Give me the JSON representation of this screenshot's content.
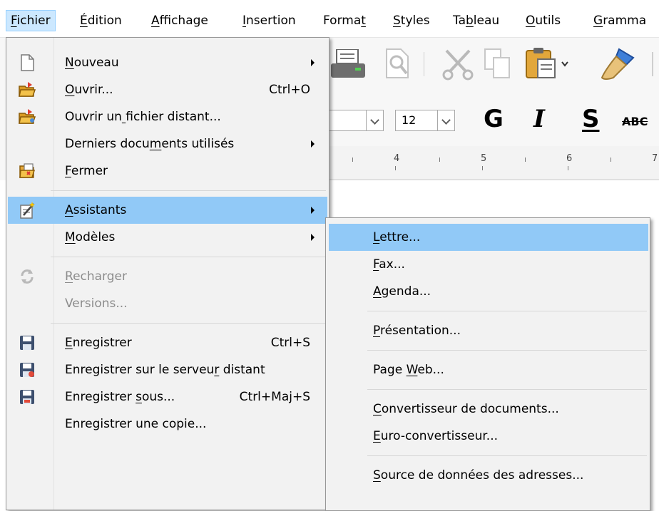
{
  "menubar": {
    "items": [
      {
        "label": "Fichier",
        "ul": 0
      },
      {
        "label": "Édition",
        "ul": 0
      },
      {
        "label": "Affichage",
        "ul": 0
      },
      {
        "label": "Insertion",
        "ul": 0
      },
      {
        "label": "Format",
        "ul": 5
      },
      {
        "label": "Styles",
        "ul": 0
      },
      {
        "label": "Tableau",
        "ul": 2
      },
      {
        "label": "Outils",
        "ul": 0
      },
      {
        "label": "Gramma",
        "ul": 0
      }
    ]
  },
  "toolbar": {
    "font_size": "12",
    "bold_glyph": "G",
    "italic_glyph": "I",
    "underline_glyph": "S",
    "strike_glyph": "ABC",
    "ruler_numbers": [
      "4",
      "5",
      "6",
      "7"
    ]
  },
  "file_menu": {
    "items": [
      {
        "label": "Nouveau",
        "ul": 0,
        "arrow": true,
        "icon": "new-document-icon"
      },
      {
        "label": "Ouvrir...",
        "ul": 0,
        "shortcut": "Ctrl+O",
        "icon": "open-folder-icon"
      },
      {
        "label": "Ouvrir un fichier distant...",
        "ul": 9,
        "icon": "open-remote-folder-icon"
      },
      {
        "label": "Derniers documents utilisés",
        "ul": 13,
        "arrow": true
      },
      {
        "label": "Fermer",
        "ul": 0,
        "icon": "close-document-icon"
      },
      {
        "separator": true
      },
      {
        "label": "Assistants",
        "ul": 0,
        "arrow": true,
        "highlighted": true,
        "icon": "wizard-icon"
      },
      {
        "label": "Modèles",
        "ul": 0,
        "arrow": true
      },
      {
        "separator": true
      },
      {
        "label": "Recharger",
        "ul": 0,
        "disabled": true,
        "icon": "reload-icon"
      },
      {
        "label": "Versions...",
        "disabled": true
      },
      {
        "separator": true
      },
      {
        "label": "Enregistrer",
        "ul": 0,
        "shortcut": "Ctrl+S",
        "icon": "save-icon"
      },
      {
        "label": "Enregistrer sur le serveur distant",
        "ul": 25,
        "icon": "save-remote-icon"
      },
      {
        "label": "Enregistrer sous...",
        "ul": 12,
        "shortcut": "Ctrl+Maj+S",
        "icon": "save-as-icon"
      },
      {
        "label": "Enregistrer une copie..."
      }
    ]
  },
  "wizards_submenu": {
    "items": [
      {
        "label": "Lettre...",
        "ul": 0,
        "highlighted": true
      },
      {
        "label": "Fax...",
        "ul": 0
      },
      {
        "label": "Agenda...",
        "ul": 0
      },
      {
        "separator": true
      },
      {
        "label": "Présentation...",
        "ul": 0
      },
      {
        "separator": true
      },
      {
        "label": "Page Web...",
        "ul": 5
      },
      {
        "separator": true
      },
      {
        "label": "Convertisseur de documents...",
        "ul": 0
      },
      {
        "label": "Euro-convertisseur...",
        "ul": 0
      },
      {
        "separator": true
      },
      {
        "label": "Source de données des adresses...",
        "ul": 0
      }
    ]
  }
}
